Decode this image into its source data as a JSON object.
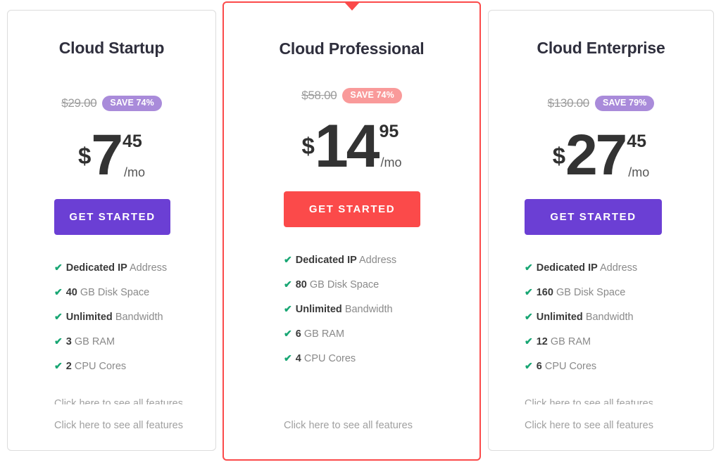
{
  "colors": {
    "purple_accent": "#6b3fd4",
    "red_accent": "#fb4a4a",
    "badge_purple": "#a98bda",
    "badge_red": "#f99a9a",
    "tick_green": "#18a673",
    "title_dark": "#2f2f3d",
    "muted_text": "#8a8a8a",
    "card_border": "#dcdcdc"
  },
  "icons": {
    "tick": "✔",
    "featured_notch": "triangle-down-icon"
  },
  "plans": [
    {
      "id": "cloud-startup",
      "title": "Cloud Startup",
      "old_price": "$29.00",
      "save_label": "SAVE 74%",
      "currency": "$",
      "amount": "7",
      "cents": "45",
      "period": "/mo",
      "cta_label": "GET STARTED",
      "featured": false,
      "features": [
        {
          "strong": "Dedicated IP",
          "rest": " Address"
        },
        {
          "strong": "40",
          "rest": " GB Disk Space"
        },
        {
          "strong": "Unlimited",
          "rest": " Bandwidth"
        },
        {
          "strong": "3",
          "rest": " GB RAM"
        },
        {
          "strong": "2",
          "rest": " CPU Cores"
        }
      ],
      "footer_links": [
        "Click here to see all features",
        "Click here to see all features"
      ]
    },
    {
      "id": "cloud-professional",
      "title": "Cloud Professional",
      "old_price": "$58.00",
      "save_label": "SAVE 74%",
      "currency": "$",
      "amount": "14",
      "cents": "95",
      "period": "/mo",
      "cta_label": "GET STARTED",
      "featured": true,
      "features": [
        {
          "strong": "Dedicated IP",
          "rest": " Address"
        },
        {
          "strong": "80",
          "rest": " GB Disk Space"
        },
        {
          "strong": "Unlimited",
          "rest": " Bandwidth"
        },
        {
          "strong": "6",
          "rest": " GB RAM"
        },
        {
          "strong": "4",
          "rest": " CPU Cores"
        }
      ],
      "footer_links": [
        "Click here to see all features"
      ]
    },
    {
      "id": "cloud-enterprise",
      "title": "Cloud Enterprise",
      "old_price": "$130.00",
      "save_label": "SAVE 79%",
      "currency": "$",
      "amount": "27",
      "cents": "45",
      "period": "/mo",
      "cta_label": "GET STARTED",
      "featured": false,
      "features": [
        {
          "strong": "Dedicated IP",
          "rest": " Address"
        },
        {
          "strong": "160",
          "rest": " GB Disk Space"
        },
        {
          "strong": "Unlimited",
          "rest": " Bandwidth"
        },
        {
          "strong": "12",
          "rest": " GB RAM"
        },
        {
          "strong": "6",
          "rest": " CPU Cores"
        }
      ],
      "footer_links": [
        "Click here to see all features",
        "Click here to see all features"
      ]
    }
  ]
}
